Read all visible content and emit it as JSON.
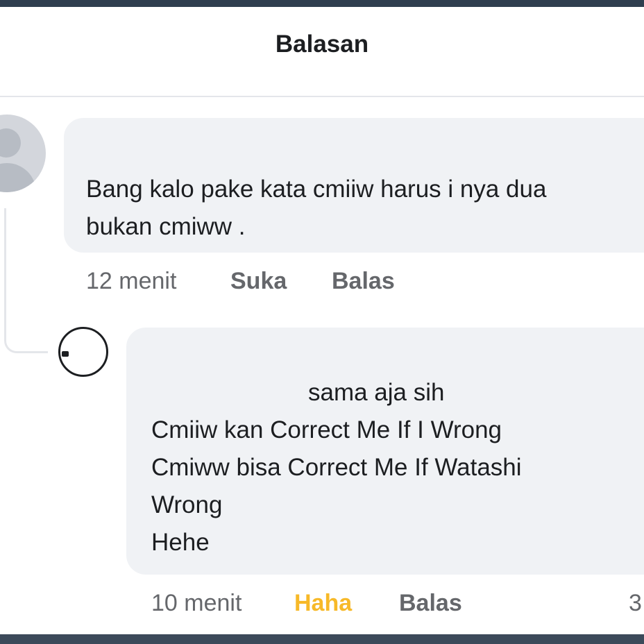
{
  "header": {
    "title": "Balasan"
  },
  "comment": {
    "text": "Bang kalo pake kata cmiiw harus i nya dua\nbukan cmiww .",
    "time": "12 menit",
    "like_label": "Suka",
    "reply_label": "Balas"
  },
  "reply": {
    "lines": [
      "sama aja sih",
      "Cmiiw kan Correct Me If I Wrong",
      "Cmiww bisa Correct Me If Watashi",
      "Wrong",
      "Hehe"
    ],
    "time": "10 menit",
    "reaction_label": "Haha",
    "reply_label": "Balas",
    "reaction_count": "3"
  },
  "colors": {
    "reaction": "#f7b928",
    "bubble": "#f0f2f5",
    "meta_text": "#65676b"
  }
}
